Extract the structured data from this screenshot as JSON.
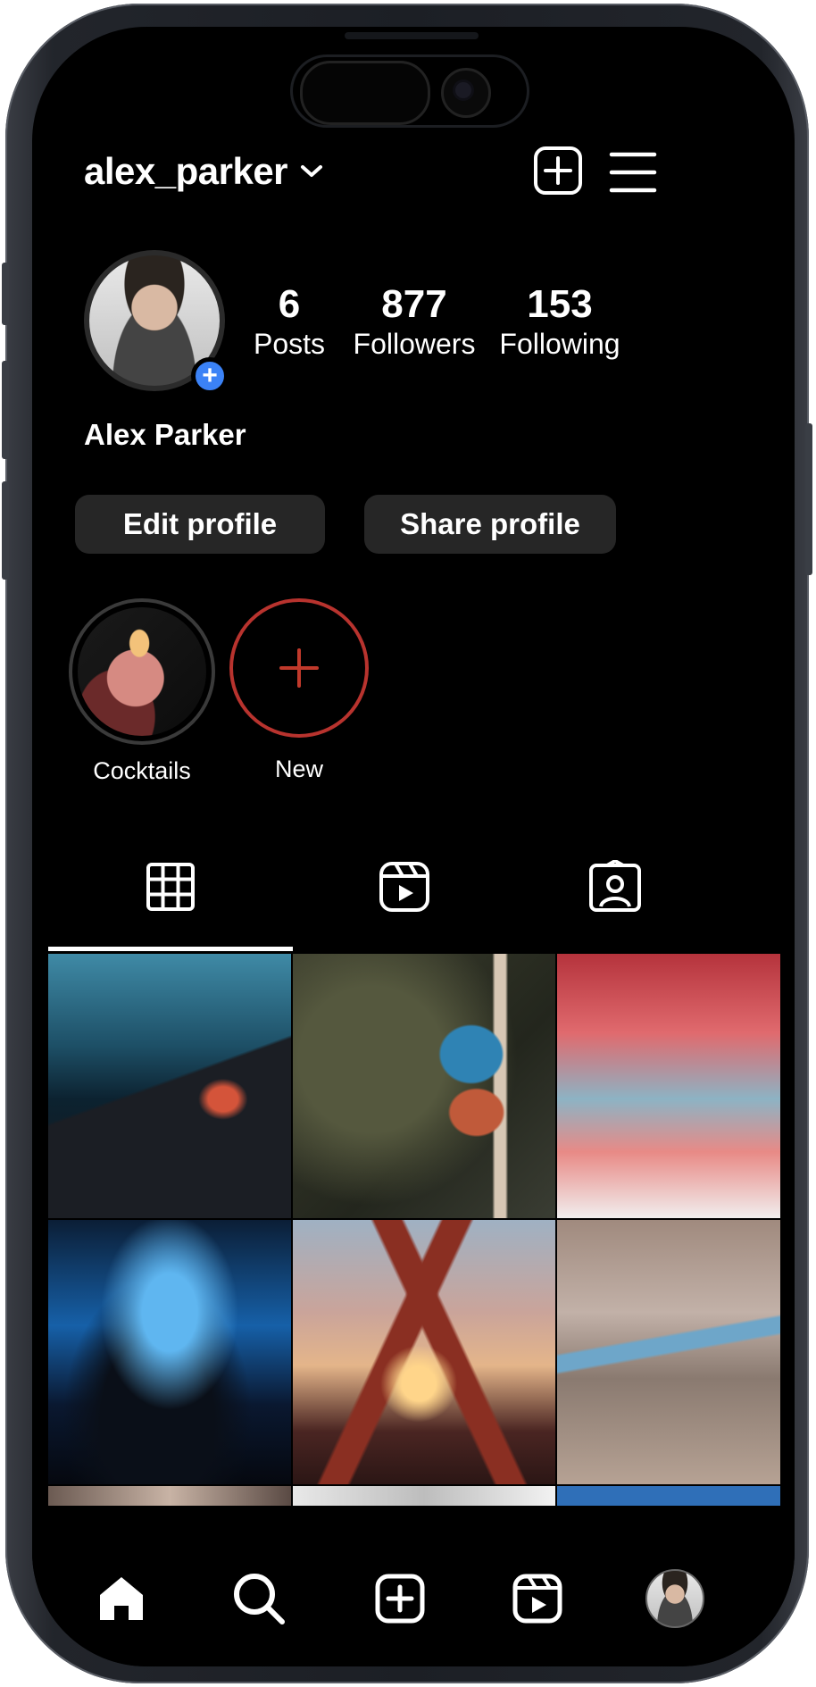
{
  "header": {
    "username": "alex_parker"
  },
  "profile": {
    "display_name": "Alex Parker",
    "stats": [
      {
        "value": "6",
        "label": "Posts"
      },
      {
        "value": "877",
        "label": "Followers"
      },
      {
        "value": "153",
        "label": "Following"
      }
    ],
    "buttons": {
      "edit": "Edit profile",
      "share": "Share profile"
    }
  },
  "highlights": [
    {
      "label": "Cocktails"
    },
    {
      "label": "New"
    }
  ],
  "tabs": [
    "grid-icon",
    "reels-icon",
    "tagged-icon"
  ],
  "posts": [
    "mountain-lava-post",
    "kingfisher-bird-post",
    "red-sky-post",
    "blue-concert-post",
    "beer-toast-post",
    "aerial-coast-post"
  ],
  "nav": [
    "home-icon",
    "search-icon",
    "create-icon",
    "reels-icon",
    "profile-avatar"
  ],
  "colors": {
    "background": "#000000",
    "button_bg": "#262626",
    "accent_blue": "#3b82f6",
    "new_highlight_red": "#c0392b"
  }
}
